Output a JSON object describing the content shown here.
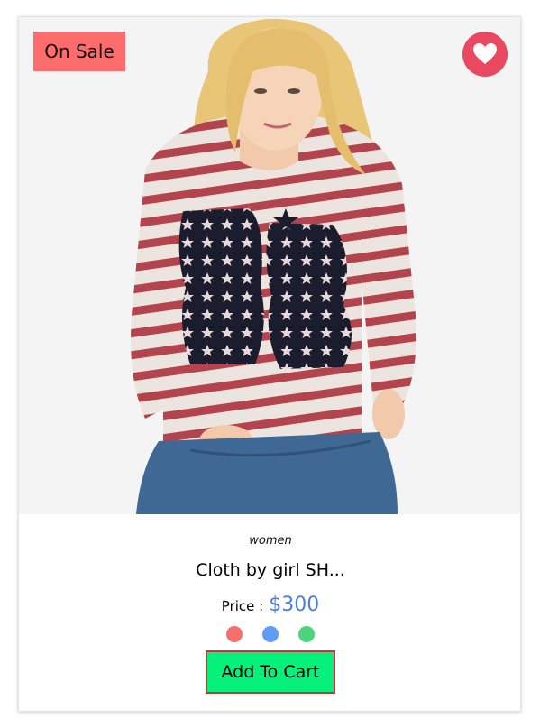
{
  "product": {
    "badge": "On Sale",
    "category": "women",
    "title": "Cloth by girl SH...",
    "price_label": "Price :",
    "price_value": "$300",
    "add_to_cart_label": "Add To Cart",
    "image_alt": "Woman wearing striped sweater with 86 print",
    "wishlist_icon": "heart-icon",
    "color_swatches": [
      {
        "name": "red",
        "color": "#f46e6e"
      },
      {
        "name": "blue",
        "color": "#5e9cf5"
      },
      {
        "name": "green",
        "color": "#4cd37b"
      }
    ]
  },
  "colors": {
    "badge_bg": "#fd6d6d",
    "wish_bg": "#ea4760",
    "price": "#4a7fe0",
    "button_bg": "#06f07c",
    "button_border": "#c5383a"
  }
}
